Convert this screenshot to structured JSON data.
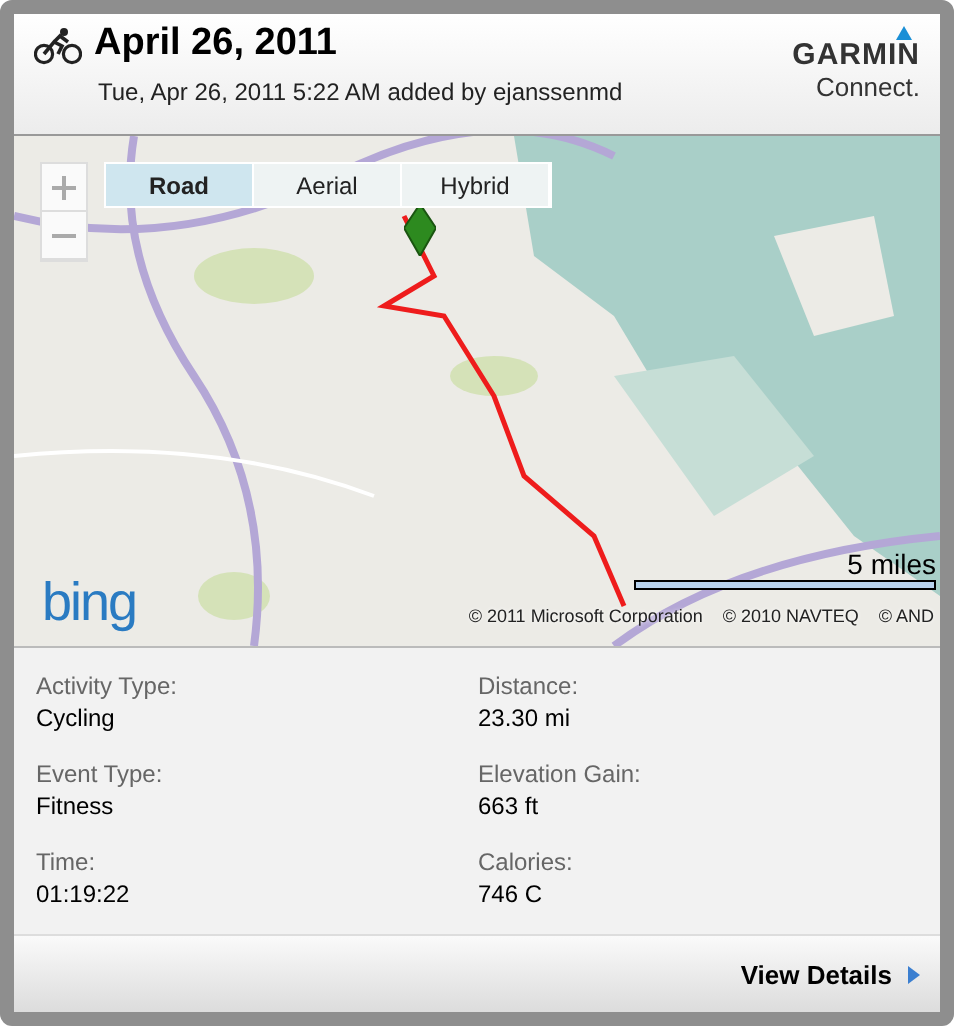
{
  "activity": {
    "title": "April 26, 2011",
    "subtitle": "Tue, Apr 26, 2011 5:22 AM added by ejanssenmd"
  },
  "logo": {
    "brand": "GARMIN",
    "product": "Connect."
  },
  "map": {
    "layers": [
      {
        "label": "Road",
        "selected": true
      },
      {
        "label": "Aerial",
        "selected": false
      },
      {
        "label": "Hybrid",
        "selected": false
      }
    ],
    "provider": "bing",
    "scale": "5 miles",
    "credits": [
      "© 2011 Microsoft Corporation",
      "© 2010 NAVTEQ",
      "© AND"
    ]
  },
  "stats": [
    {
      "label": "Activity Type:",
      "value": "Cycling"
    },
    {
      "label": "Distance:",
      "value": "23.30 mi"
    },
    {
      "label": "Event Type:",
      "value": "Fitness"
    },
    {
      "label": "Elevation Gain:",
      "value": "663 ft"
    },
    {
      "label": "Time:",
      "value": "01:19:22"
    },
    {
      "label": "Calories:",
      "value": "746 C"
    }
  ],
  "footer": {
    "link": "View Details"
  }
}
